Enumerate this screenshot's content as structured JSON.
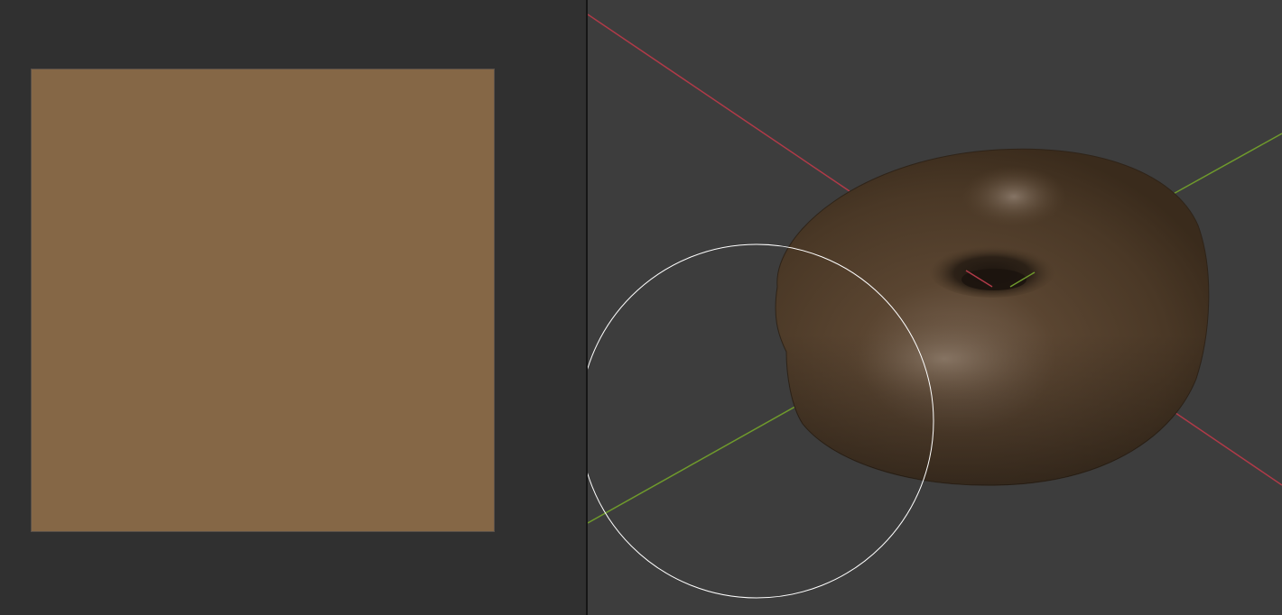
{
  "image_editor": {
    "texture": {
      "color": "#856746"
    },
    "background_color": "#303030"
  },
  "viewport": {
    "background_color": "#3d3d3d",
    "axis_x_color": "#b03a48",
    "axis_y_color": "#6f9a2c",
    "object": {
      "name": "donut",
      "base_color": "#4e3d2b"
    },
    "brush_cursor": {
      "color": "#ffffff"
    }
  }
}
